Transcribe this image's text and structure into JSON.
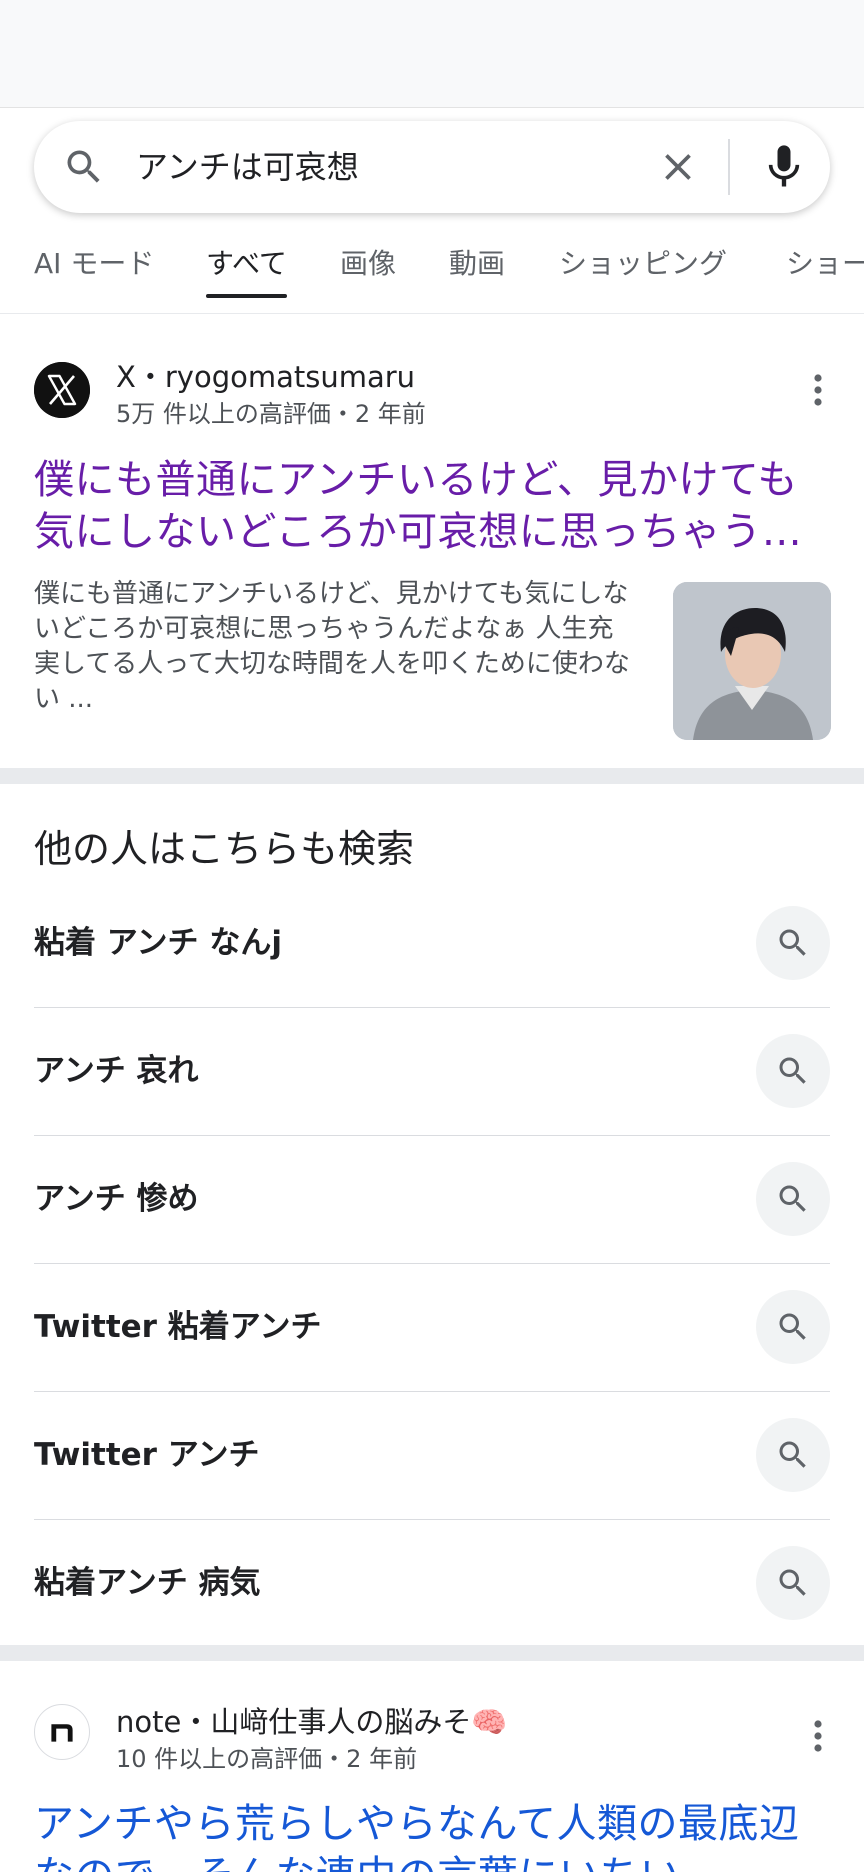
{
  "search": {
    "query": "アンチは可哀想"
  },
  "tabs": [
    {
      "label": "AI モード"
    },
    {
      "label": "すべて"
    },
    {
      "label": "画像"
    },
    {
      "label": "動画"
    },
    {
      "label": "ショッピング"
    },
    {
      "label": "ショー"
    }
  ],
  "active_tab": "すべて",
  "results": [
    {
      "source": "X",
      "author": "ryogomatsumaru",
      "site_line": "X・ryogomatsumaru",
      "meta": "5万 件以上の高評価・2 年前",
      "title": "僕にも普通にアンチいるけど、見かけても気にしないどころか可哀想に思っちゃう…",
      "snippet": "僕にも普通にアンチいるけど、見かけても気にしないどころか可哀想に思っちゃうんだよなぁ 人生充実してる人って大切な時間を人を叩くために使わない ...",
      "visited": true
    },
    {
      "source": "note",
      "author": "山﨑仕事人の脳みそ🧠",
      "site_line": "note・山﨑仕事人の脳みそ🧠",
      "meta": "10 件以上の高評価・2 年前",
      "title": "アンチやら荒らしやらなんて人類の最底辺なので、そんな連中の言葉にいちい",
      "visited": false
    }
  ],
  "related": {
    "title": "他の人はこちらも検索",
    "items": [
      {
        "label": "粘着 アンチ なんj"
      },
      {
        "label": "アンチ 哀れ"
      },
      {
        "label": "アンチ 惨め"
      },
      {
        "label": "Twitter 粘着アンチ"
      },
      {
        "label": "Twitter アンチ"
      },
      {
        "label": "粘着アンチ 病気"
      }
    ]
  },
  "colors": {
    "visited_link": "#681da8",
    "link": "#1558d6",
    "text": "#202124",
    "secondary_text": "#4d5156"
  },
  "icons": {
    "search": "search-icon",
    "clear": "close-icon",
    "mic": "microphone-icon",
    "more": "more-vert-icon",
    "x_logo": "x-logo-icon",
    "note_logo": "note-logo-icon"
  }
}
